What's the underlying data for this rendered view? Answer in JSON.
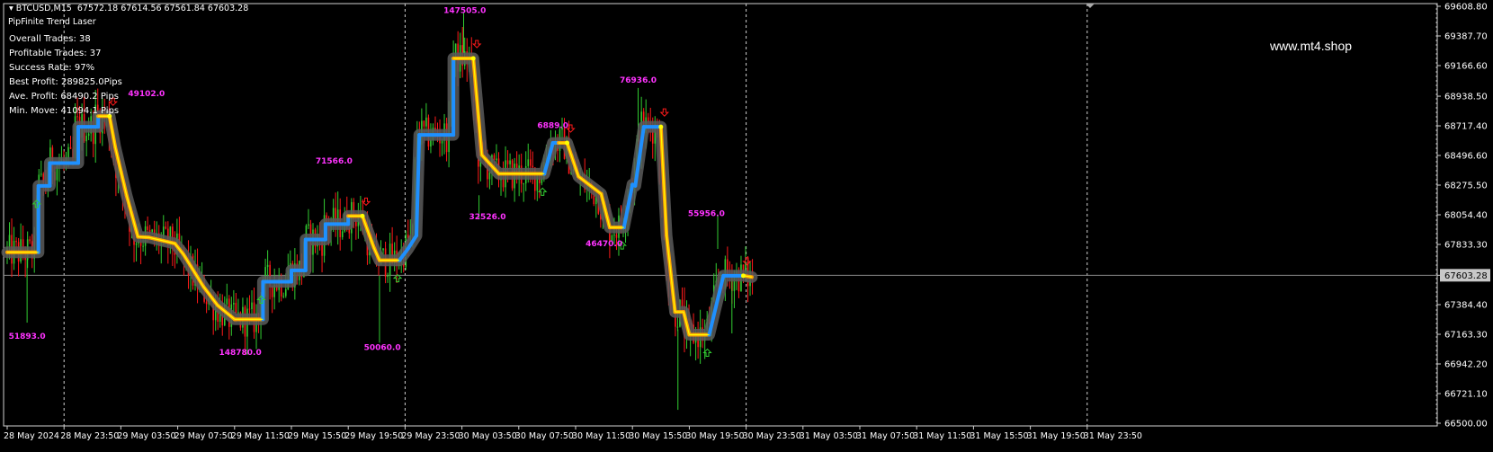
{
  "header": {
    "symbol": "BTCUSD,M15",
    "ohlc": "67572.18 67614.56 67561.84 67603.28"
  },
  "indicator_name": "PipFinite Trend Laser",
  "stats": {
    "overall_trades": "Overall Trades: 38",
    "profitable_trades": "Profitable Trades: 37",
    "success_rate": "Success Rate: 97%",
    "best_profit": "Best Profit: 289825.0Pips",
    "ave_profit": "Ave. Profit: 68490.2 Pips",
    "min_move": "Min. Move: 41094.1 Pips"
  },
  "watermark": "www.mt4.shop",
  "colors": {
    "background": "#000000",
    "bull_candle": "#32cd32",
    "bear_candle": "#ff1a1a",
    "laser_up": "#1e90ff",
    "laser_down": "#ffa500",
    "laser_core": "#ffff00",
    "laser_glow": "#5a5a5a",
    "label_magenta": "#ff33ff",
    "grid": "#ffffff"
  },
  "chart_data": {
    "type": "candlestick",
    "title": "",
    "xlabel": "",
    "ylabel": "",
    "ylim": [
      66500.0,
      69608.8
    ],
    "current_price": "67603.28",
    "y_ticks": [
      "69608.80",
      "69387.70",
      "69166.60",
      "68938.50",
      "68717.40",
      "68496.60",
      "68275.50",
      "68054.40",
      "67833.30",
      "67603.28",
      "67384.40",
      "67163.30",
      "66942.20",
      "66721.10",
      "66500.00"
    ],
    "x_ticks": [
      "28 May 2024",
      "28 May 23:50",
      "29 May 03:50",
      "29 May 07:50",
      "29 May 11:50",
      "29 May 15:50",
      "29 May 19:50",
      "29 May 23:50",
      "30 May 03:50",
      "30 May 07:50",
      "30 May 11:50",
      "30 May 15:50",
      "30 May 19:50",
      "30 May 23:50",
      "31 May 03:50",
      "31 May 07:50",
      "31 May 11:50",
      "31 May 15:50",
      "31 May 19:50",
      "31 May 23:50"
    ],
    "trend_laser": [
      {
        "x": 0,
        "y": 67775,
        "trend": "down"
      },
      {
        "x": 0.55,
        "y": 67775,
        "trend": "down"
      },
      {
        "x": 0.55,
        "y": 68270,
        "trend": "up"
      },
      {
        "x": 0.75,
        "y": 68270,
        "trend": "up"
      },
      {
        "x": 0.75,
        "y": 68440,
        "trend": "up"
      },
      {
        "x": 1.25,
        "y": 68440,
        "trend": "up"
      },
      {
        "x": 1.25,
        "y": 68710,
        "trend": "up"
      },
      {
        "x": 1.6,
        "y": 68710,
        "trend": "up"
      },
      {
        "x": 1.6,
        "y": 68790,
        "trend": "up"
      },
      {
        "x": 1.8,
        "y": 68790,
        "trend": "down"
      },
      {
        "x": 1.9,
        "y": 68560,
        "trend": "down"
      },
      {
        "x": 2.1,
        "y": 68200,
        "trend": "down"
      },
      {
        "x": 2.3,
        "y": 67890,
        "trend": "down"
      },
      {
        "x": 2.5,
        "y": 67885,
        "trend": "down"
      },
      {
        "x": 2.95,
        "y": 67840,
        "trend": "down"
      },
      {
        "x": 3.1,
        "y": 67760,
        "trend": "down"
      },
      {
        "x": 3.45,
        "y": 67520,
        "trend": "down"
      },
      {
        "x": 3.7,
        "y": 67380,
        "trend": "down"
      },
      {
        "x": 4.0,
        "y": 67275,
        "trend": "down"
      },
      {
        "x": 4.5,
        "y": 67275,
        "trend": "down"
      },
      {
        "x": 4.5,
        "y": 67555,
        "trend": "up"
      },
      {
        "x": 5.0,
        "y": 67555,
        "trend": "up"
      },
      {
        "x": 5.0,
        "y": 67640,
        "trend": "up"
      },
      {
        "x": 5.25,
        "y": 67640,
        "trend": "up"
      },
      {
        "x": 5.25,
        "y": 67870,
        "trend": "up"
      },
      {
        "x": 5.6,
        "y": 67870,
        "trend": "up"
      },
      {
        "x": 5.6,
        "y": 67985,
        "trend": "up"
      },
      {
        "x": 6.0,
        "y": 67985,
        "trend": "up"
      },
      {
        "x": 6.0,
        "y": 68045,
        "trend": "up"
      },
      {
        "x": 6.25,
        "y": 68045,
        "trend": "down"
      },
      {
        "x": 6.45,
        "y": 67810,
        "trend": "down"
      },
      {
        "x": 6.55,
        "y": 67715,
        "trend": "down"
      },
      {
        "x": 6.9,
        "y": 67715,
        "trend": "down"
      },
      {
        "x": 6.9,
        "y": 67715,
        "trend": "up"
      },
      {
        "x": 7.05,
        "y": 67800,
        "trend": "up"
      },
      {
        "x": 7.2,
        "y": 67900,
        "trend": "up"
      },
      {
        "x": 7.25,
        "y": 68650,
        "trend": "up"
      },
      {
        "x": 7.85,
        "y": 68650,
        "trend": "up"
      },
      {
        "x": 7.85,
        "y": 69220,
        "trend": "up"
      },
      {
        "x": 8.2,
        "y": 69220,
        "trend": "down"
      },
      {
        "x": 8.35,
        "y": 68500,
        "trend": "down"
      },
      {
        "x": 8.65,
        "y": 68360,
        "trend": "down"
      },
      {
        "x": 9.45,
        "y": 68360,
        "trend": "down"
      },
      {
        "x": 9.45,
        "y": 68360,
        "trend": "up"
      },
      {
        "x": 9.6,
        "y": 68590,
        "trend": "up"
      },
      {
        "x": 9.7,
        "y": 68590,
        "trend": "up"
      },
      {
        "x": 9.85,
        "y": 68590,
        "trend": "down"
      },
      {
        "x": 10.05,
        "y": 68340,
        "trend": "down"
      },
      {
        "x": 10.45,
        "y": 68210,
        "trend": "down"
      },
      {
        "x": 10.6,
        "y": 67960,
        "trend": "down"
      },
      {
        "x": 10.85,
        "y": 67960,
        "trend": "down"
      },
      {
        "x": 10.85,
        "y": 67960,
        "trend": "up"
      },
      {
        "x": 11.0,
        "y": 68280,
        "trend": "up"
      },
      {
        "x": 11.05,
        "y": 68270,
        "trend": "up"
      },
      {
        "x": 11.2,
        "y": 68710,
        "trend": "up"
      },
      {
        "x": 11.5,
        "y": 68710,
        "trend": "up"
      },
      {
        "x": 11.5,
        "y": 68710,
        "trend": "down"
      },
      {
        "x": 11.6,
        "y": 67900,
        "trend": "down"
      },
      {
        "x": 11.75,
        "y": 67330,
        "trend": "down"
      },
      {
        "x": 11.9,
        "y": 67330,
        "trend": "down"
      },
      {
        "x": 12.0,
        "y": 67160,
        "trend": "down"
      },
      {
        "x": 12.35,
        "y": 67160,
        "trend": "down"
      },
      {
        "x": 12.35,
        "y": 67160,
        "trend": "up"
      },
      {
        "x": 12.6,
        "y": 67600,
        "trend": "up"
      },
      {
        "x": 12.95,
        "y": 67600,
        "trend": "up"
      },
      {
        "x": 12.95,
        "y": 67600,
        "trend": "down"
      },
      {
        "x": 13.1,
        "y": 67590,
        "trend": "down"
      }
    ],
    "annotations": [
      {
        "text": "51893.0",
        "x": 0.35,
        "y": 67130
      },
      {
        "text": "49102.0",
        "x": 2.45,
        "y": 68940
      },
      {
        "text": "148780.0",
        "x": 4.1,
        "y": 67010
      },
      {
        "text": "71566.0",
        "x": 5.75,
        "y": 68435
      },
      {
        "text": "50060.0",
        "x": 6.6,
        "y": 67045
      },
      {
        "text": "147505.0",
        "x": 8.05,
        "y": 69560
      },
      {
        "text": "32526.0",
        "x": 8.45,
        "y": 68020
      },
      {
        "text": "6889.0",
        "x": 9.6,
        "y": 68700
      },
      {
        "text": "46470.0",
        "x": 10.5,
        "y": 67820
      },
      {
        "text": "76936.0",
        "x": 11.1,
        "y": 69040
      },
      {
        "text": "55956.0",
        "x": 12.3,
        "y": 68045
      }
    ],
    "series": [
      {
        "name": "",
        "trend": "flat_down",
        "from": 0,
        "to": 0.55,
        "level": 67770
      },
      {
        "name": "",
        "trend": "up",
        "from": 0.55,
        "to": 1.7,
        "level": 68480
      },
      {
        "name": "",
        "trend": "down",
        "from": 1.7,
        "to": 4.3,
        "level": 67600
      },
      {
        "name": "",
        "trend": "up",
        "from": 4.3,
        "to": 6.1,
        "level": 67800
      },
      {
        "name": "",
        "trend": "down",
        "from": 6.1,
        "to": 6.9,
        "level": 67700
      },
      {
        "name": "",
        "trend": "up",
        "from": 6.9,
        "to": 8.2,
        "level": 68700
      },
      {
        "name": "",
        "trend": "down",
        "from": 8.2,
        "to": 9.5,
        "level": 68350
      },
      {
        "name": "",
        "trend": "up",
        "from": 9.5,
        "to": 9.8,
        "level": 68550
      },
      {
        "name": "",
        "trend": "down",
        "from": 9.8,
        "to": 10.8,
        "level": 68200
      },
      {
        "name": "",
        "trend": "up",
        "from": 10.8,
        "to": 11.5,
        "level": 68500
      },
      {
        "name": "",
        "trend": "down",
        "from": 11.5,
        "to": 12.35,
        "level": 67250
      },
      {
        "name": "",
        "trend": "up",
        "from": 12.35,
        "to": 13.1,
        "level": 67580
      }
    ],
    "grid": false,
    "day_separators_at": [
      1,
      7,
      13,
      19
    ]
  }
}
